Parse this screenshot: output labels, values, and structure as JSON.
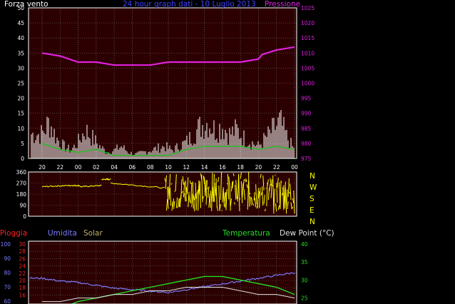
{
  "texts": {
    "wind_label": "Forza vento",
    "title": "24 hour graph dati - 10 Luglio 2013",
    "pressure_label": "Pressione",
    "compass": [
      "N",
      "W",
      "S",
      "E",
      "N"
    ],
    "pioggia": "Pioggia",
    "umidita": "Umidita",
    "solar": "Solar",
    "temperatura": "Temperatura",
    "dewpoint": "Dew Point (°C)"
  },
  "colors": {
    "plot_bg": "#2c0000",
    "grid": "#6a6a6a",
    "pressure": "#e020e0",
    "wind_white": "#ffffff",
    "wind_green": "#22c022",
    "direction": "#ffff00",
    "humidity": "#7a7aff",
    "rain": "#ff2020",
    "solar": "#c8b070",
    "temperature": "#22e022",
    "dewpoint": "#e0e0e0"
  },
  "chart_data": [
    {
      "type": "line",
      "name": "wind_and_pressure",
      "x_tick_labels": [
        "20",
        "22",
        "00",
        "02",
        "04",
        "06",
        "08",
        "10",
        "12",
        "14",
        "16",
        "18",
        "20",
        "22",
        "00"
      ],
      "left_axis": {
        "ylim": [
          0,
          50
        ],
        "ticks": [
          0,
          5,
          10,
          15,
          20,
          25,
          30,
          35,
          40,
          45,
          50
        ],
        "label": "Forza vento"
      },
      "right_axis": {
        "ylim": [
          975,
          1025
        ],
        "ticks": [
          975,
          980,
          985,
          990,
          995,
          1000,
          1005,
          1010,
          1015,
          1020,
          1025
        ],
        "label": "Pressione"
      },
      "pressure": {
        "x": [
          0,
          1,
          2,
          3,
          4,
          5,
          6,
          7,
          8,
          9,
          10,
          11,
          12,
          12.2,
          13,
          14
        ],
        "y": [
          1010,
          1009,
          1007,
          1007,
          1006,
          1006,
          1006,
          1007,
          1007,
          1007,
          1007,
          1007,
          1008,
          1009.5,
          1011,
          1012
        ]
      },
      "wind_gust_envelope": {
        "x": [
          0,
          0.4,
          0.8,
          1.2,
          1.6,
          2,
          2.4,
          2.8,
          3.2,
          3.6,
          4,
          4.4,
          4.8,
          5.2,
          5.6,
          6,
          6.4,
          6.8,
          7.2,
          7.6,
          8,
          8.4,
          8.8,
          9.2,
          9.6,
          10,
          10.4,
          10.8,
          11.2,
          11.6,
          12,
          12.4,
          12.8,
          13.2,
          13.6,
          14
        ],
        "y": [
          12,
          18,
          10,
          6,
          4,
          8,
          14,
          10,
          6,
          3,
          4,
          6,
          3,
          2,
          3,
          4,
          5,
          6,
          4,
          6,
          8,
          12,
          16,
          18,
          14,
          16,
          12,
          14,
          10,
          8,
          6,
          10,
          14,
          18,
          10,
          4
        ]
      },
      "wind_avg": {
        "x": [
          0,
          1,
          2,
          3,
          4,
          5,
          6,
          7,
          8,
          9,
          10,
          11,
          12,
          13,
          14
        ],
        "y": [
          5,
          3,
          2,
          3,
          1,
          1,
          1,
          1,
          3,
          4,
          4,
          4,
          3,
          4,
          3
        ]
      }
    },
    {
      "type": "scatter",
      "name": "wind_direction",
      "yticks": [
        0,
        90,
        180,
        270,
        360
      ],
      "segments": [
        {
          "x": [
            0,
            1.4
          ],
          "y": [
            240,
            250
          ]
        },
        {
          "x": [
            1.4,
            2.1
          ],
          "y": [
            250,
            250
          ]
        },
        {
          "x": [
            2.1,
            3.3
          ],
          "y": [
            240,
            250
          ]
        },
        {
          "x": [
            3.3,
            3.8
          ],
          "y": [
            300,
            300
          ]
        },
        {
          "x": [
            3.8,
            6.8
          ],
          "y": [
            270,
            230
          ]
        },
        {
          "x": [
            6.8,
            12.3
          ],
          "y": [
            40,
            360
          ]
        },
        {
          "x": [
            12.3,
            14
          ],
          "y": [
            20,
            340
          ]
        }
      ]
    },
    {
      "type": "line",
      "name": "humidity_temperature",
      "left_axis_1": {
        "ticks": [
          60,
          70,
          80,
          90,
          100
        ]
      },
      "left_axis_2": {
        "ticks": [
          16,
          18,
          20,
          22,
          24,
          26,
          28,
          30
        ]
      },
      "right_axis": {
        "ticks": [
          25,
          30,
          35,
          40
        ]
      },
      "humidity": {
        "x": [
          0,
          1,
          2,
          3,
          4,
          5,
          6,
          7,
          8,
          9,
          10,
          11,
          12,
          13,
          14
        ],
        "y": [
          76,
          74,
          73,
          71,
          69,
          68,
          67,
          66,
          68,
          70,
          72,
          74,
          76,
          78,
          80
        ]
      },
      "temperature": {
        "x": [
          0,
          1,
          2,
          3,
          4,
          5,
          6,
          7,
          8,
          9,
          10,
          11,
          12,
          13,
          14
        ],
        "y": [
          20,
          22,
          24,
          25,
          26,
          27,
          28,
          29,
          30,
          31,
          31,
          30,
          29,
          28,
          26
        ]
      },
      "dew_point": {
        "x": [
          0,
          1,
          2,
          3,
          4,
          5,
          6,
          7,
          8,
          9,
          10,
          11,
          12,
          13,
          14
        ],
        "y": [
          18,
          18,
          19,
          19,
          20,
          20,
          21,
          21,
          22,
          22,
          22,
          21,
          20,
          20,
          19
        ]
      }
    }
  ]
}
